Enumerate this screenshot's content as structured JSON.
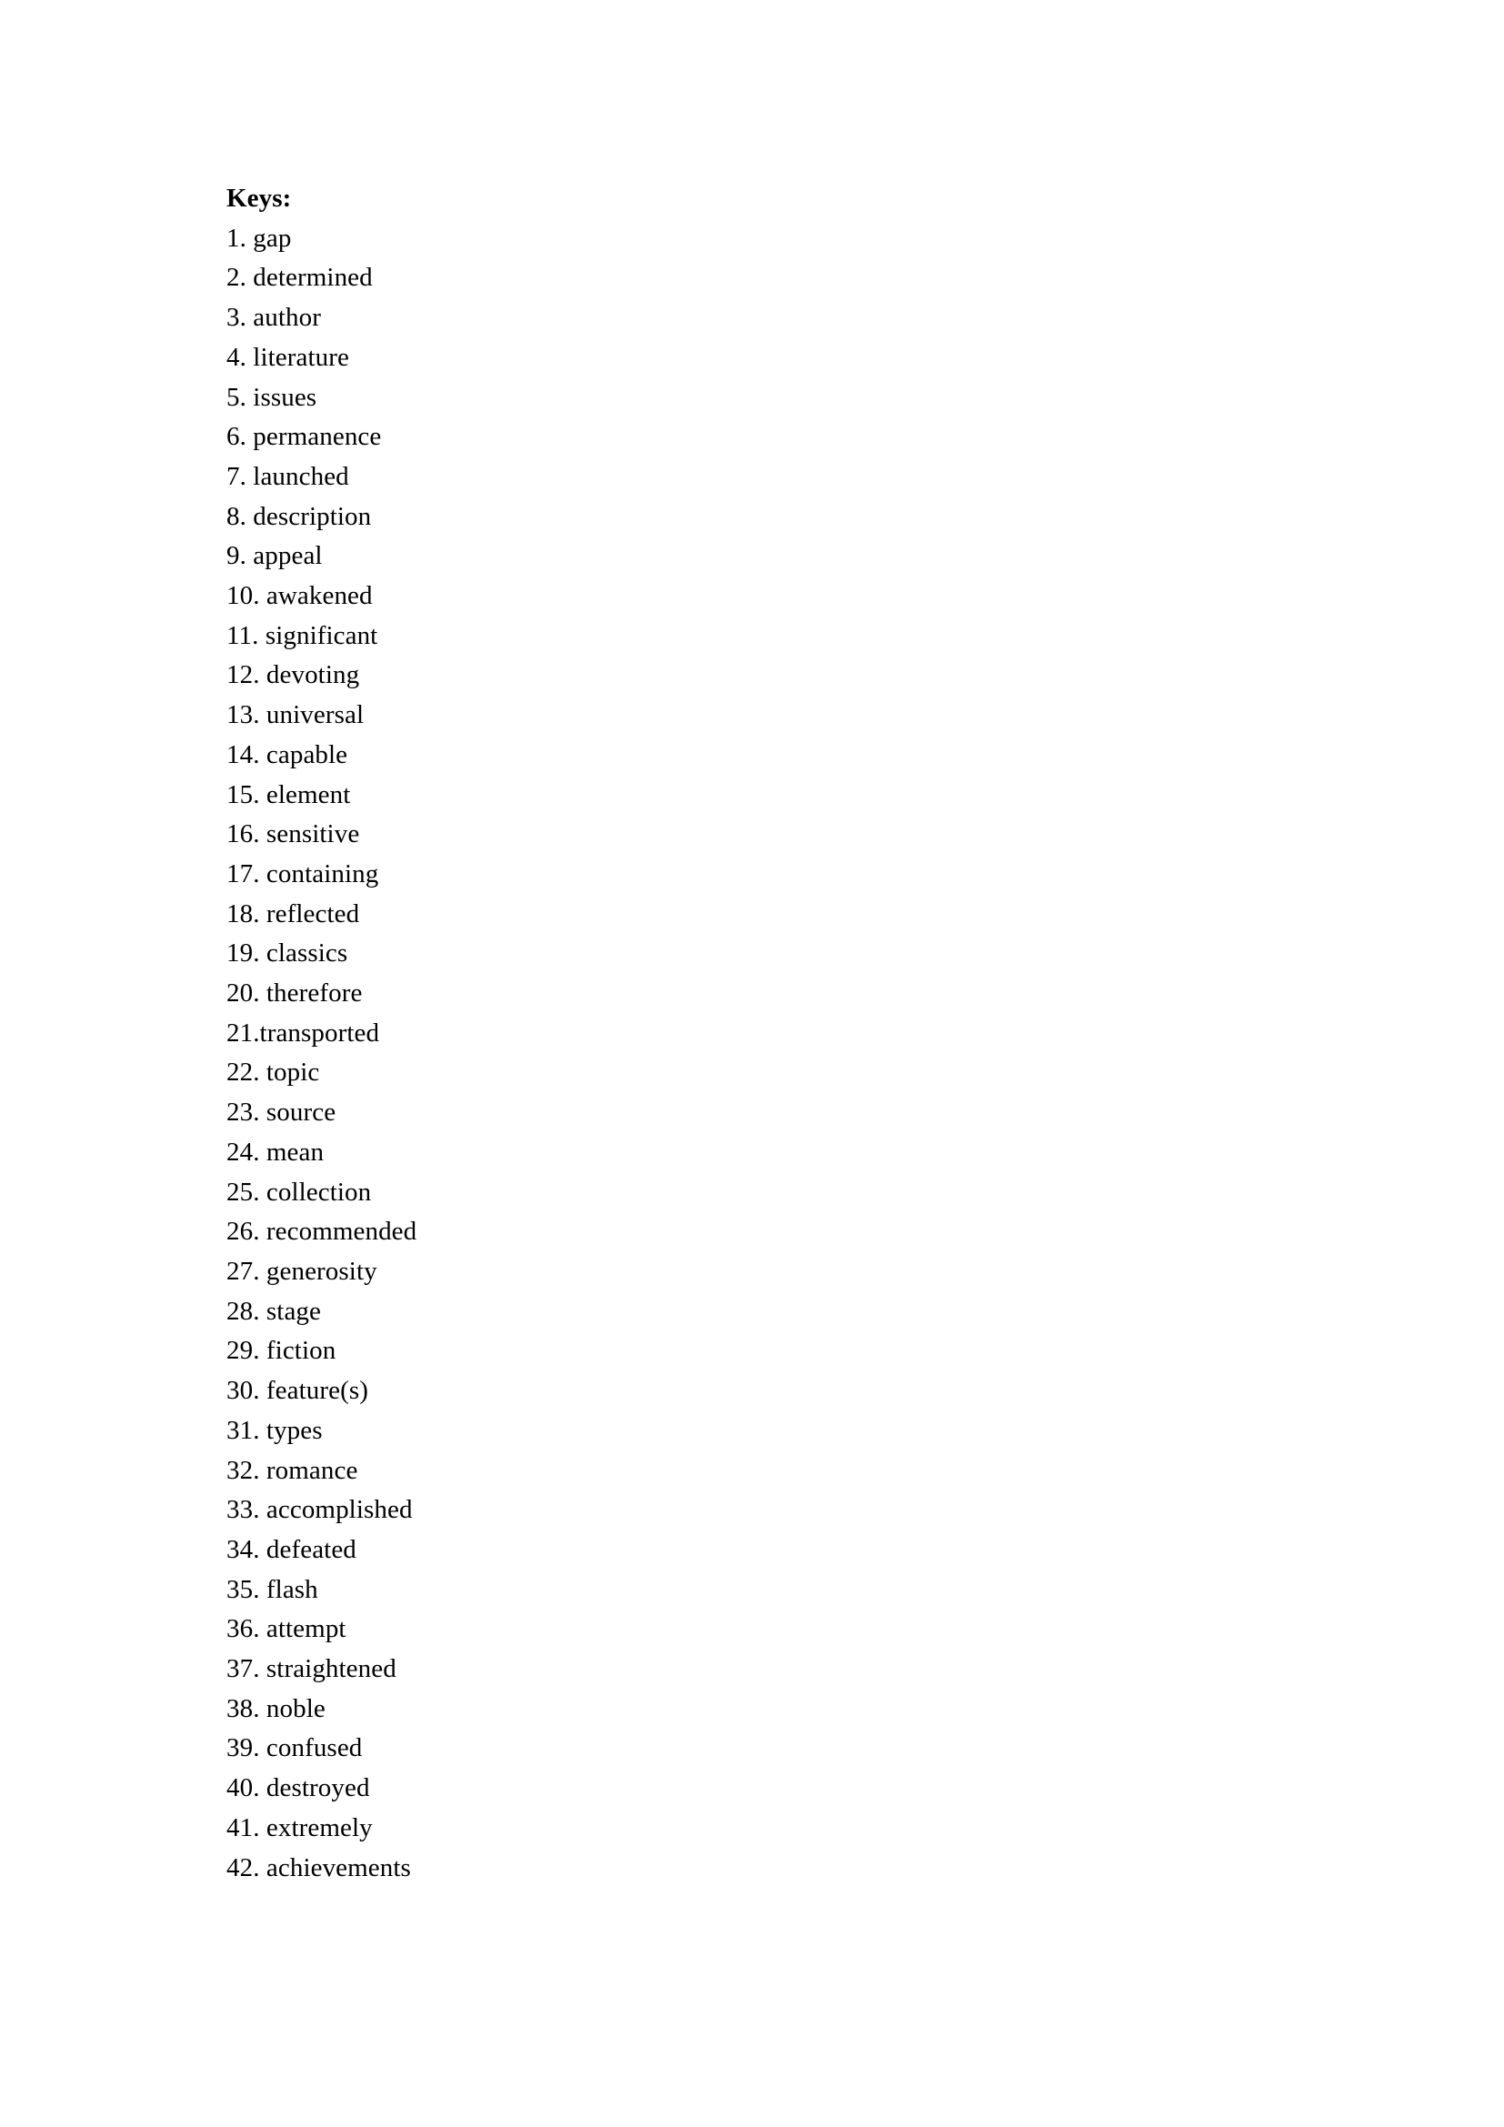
{
  "document": {
    "heading": "Keys:",
    "items": [
      "1. gap",
      "2. determined",
      "3. author",
      "4. literature",
      "5. issues",
      "6. permanence",
      "7. launched",
      "8. description",
      "9. appeal",
      "10. awakened",
      "11. significant",
      "12. devoting",
      "13. universal",
      "14. capable",
      "15. element",
      "16. sensitive",
      "17. containing",
      "18. reflected",
      "19. classics",
      "20. therefore",
      "21.transported",
      "22. topic",
      "23. source",
      "24. mean",
      "25. collection",
      "26. recommended",
      "27. generosity",
      "28. stage",
      "29. fiction",
      "30. feature(s)",
      "31. types",
      "32. romance",
      "33. accomplished",
      "34. defeated",
      "35. flash",
      "36. attempt",
      "37. straightened",
      "38. noble",
      "39. confused",
      "40. destroyed",
      "41. extremely",
      "42. achievements"
    ]
  }
}
